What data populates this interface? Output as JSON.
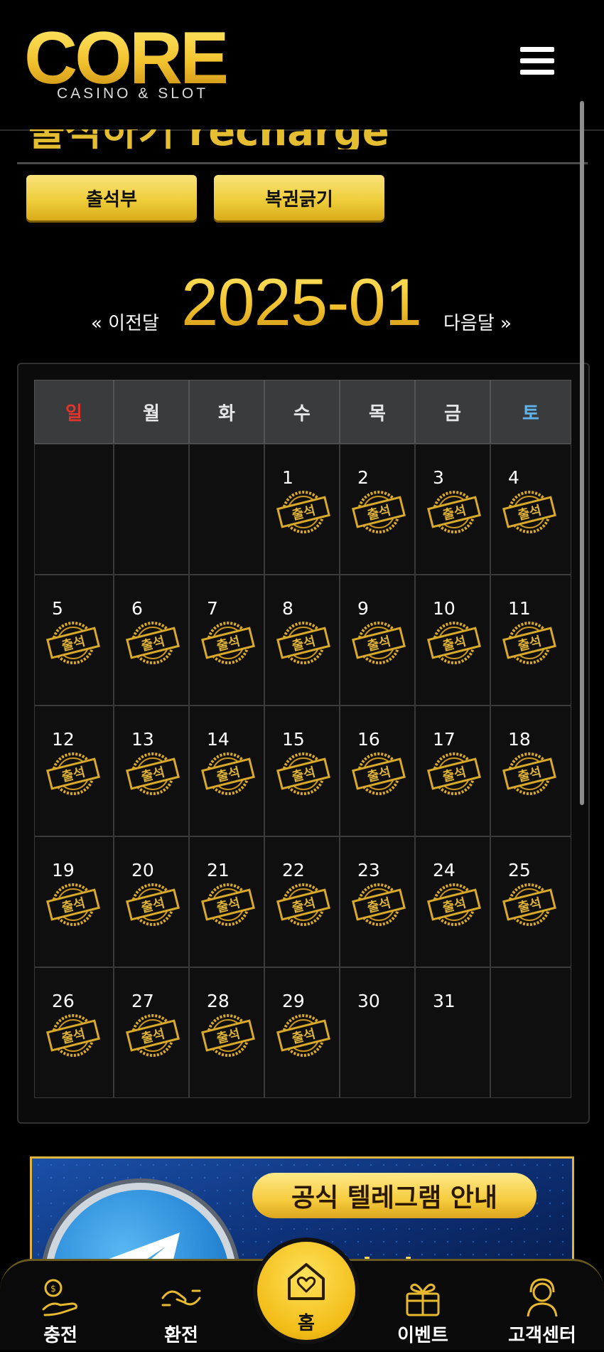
{
  "header": {
    "logo_text": "CORE",
    "logo_subtitle": "CASINO & SLOT"
  },
  "page": {
    "title": "출석하기 recharge"
  },
  "tabs": [
    {
      "label": "출석부"
    },
    {
      "label": "복권긁기"
    }
  ],
  "month_nav": {
    "prev_label": "« 이전달",
    "current": "2025-01",
    "next_label": "다음달 »"
  },
  "calendar": {
    "weekdays": [
      "일",
      "월",
      "화",
      "수",
      "목",
      "금",
      "토"
    ],
    "weeks": [
      [
        {
          "day": ""
        },
        {
          "day": ""
        },
        {
          "day": ""
        },
        {
          "day": "1",
          "stamp": true
        },
        {
          "day": "2",
          "stamp": true
        },
        {
          "day": "3",
          "stamp": true
        },
        {
          "day": "4",
          "stamp": true
        }
      ],
      [
        {
          "day": "5",
          "stamp": true
        },
        {
          "day": "6",
          "stamp": true
        },
        {
          "day": "7",
          "stamp": true
        },
        {
          "day": "8",
          "stamp": true
        },
        {
          "day": "9",
          "stamp": true
        },
        {
          "day": "10",
          "stamp": true
        },
        {
          "day": "11",
          "stamp": true
        }
      ],
      [
        {
          "day": "12",
          "stamp": true
        },
        {
          "day": "13",
          "stamp": true
        },
        {
          "day": "14",
          "stamp": true
        },
        {
          "day": "15",
          "stamp": true
        },
        {
          "day": "16",
          "stamp": true
        },
        {
          "day": "17",
          "stamp": true
        },
        {
          "day": "18",
          "stamp": true
        }
      ],
      [
        {
          "day": "19",
          "stamp": true
        },
        {
          "day": "20",
          "stamp": true
        },
        {
          "day": "21",
          "stamp": true
        },
        {
          "day": "22",
          "stamp": true
        },
        {
          "day": "23",
          "stamp": true
        },
        {
          "day": "24",
          "stamp": true
        },
        {
          "day": "25",
          "stamp": true
        }
      ],
      [
        {
          "day": "26",
          "stamp": true
        },
        {
          "day": "27",
          "stamp": true
        },
        {
          "day": "28",
          "stamp": true
        },
        {
          "day": "29",
          "stamp": true
        },
        {
          "day": "30"
        },
        {
          "day": "31"
        },
        {
          "day": ""
        }
      ]
    ],
    "stamp_text": "출석"
  },
  "banner": {
    "title": "공식 텔레그램 안내",
    "subtitle": "바로가기 OUOK"
  },
  "bottom_nav": [
    {
      "label": "충전",
      "icon": "coin-hand-icon"
    },
    {
      "label": "환전",
      "icon": "exchange-hand-icon"
    },
    {
      "label": "홈",
      "icon": "home-heart-icon"
    },
    {
      "label": "이벤트",
      "icon": "gift-icon"
    },
    {
      "label": "고객센터",
      "icon": "support-icon"
    }
  ],
  "colors": {
    "gold": "#f2c22e",
    "sunday": "#e0342c",
    "saturday": "#5fb4ee",
    "background": "#000000"
  }
}
